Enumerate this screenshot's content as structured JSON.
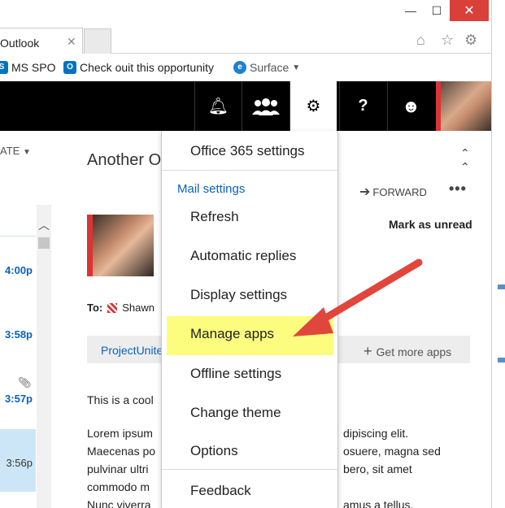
{
  "window": {
    "minimize_label": "—",
    "maximize_label": "☐",
    "close_label": "✕"
  },
  "tab": {
    "title": "Outlook",
    "close_label": "✕"
  },
  "favorites": [
    {
      "label": "MS SPO",
      "icon": "sharepoint-icon",
      "color": "#0072c6"
    },
    {
      "label": "Check ouit this opportunity",
      "icon": "outlook-icon",
      "color": "#0072c6"
    },
    {
      "label": "Surface",
      "icon": "ie-icon",
      "color": "#1e7fd2"
    }
  ],
  "header": {
    "icons": [
      "bell-icon",
      "people-icon",
      "gear-icon",
      "help-icon",
      "smiley-icon"
    ],
    "help_label": "?"
  },
  "message_list": {
    "sort_label": "ATE",
    "times": [
      "4:00p",
      "3:58p",
      "3:57p",
      "3:56p"
    ]
  },
  "reading_pane": {
    "subject": "Another O",
    "forward_label": "FORWARD",
    "mark_unread_label": "Mark as unread",
    "to_label": "To:",
    "to_name": "Shawn",
    "apps_link": "ProjectUnite",
    "get_more_apps": "Get more apps",
    "body_lines": [
      "This is a cool",
      "Lorem ipsum",
      "Maecenas po",
      "pulvinar ultri",
      "commodo m",
      "Nunc viverra"
    ],
    "body_right_lines": [
      "dipiscing elit.",
      "osuere, magna sed",
      "bero, sit amet",
      "",
      "amus a tellus."
    ]
  },
  "settings_menu": {
    "top_item": "Office 365 settings",
    "section_heading": "Mail settings",
    "items": [
      "Refresh",
      "Automatic replies",
      "Display settings",
      "Manage apps",
      "Offline settings",
      "Change theme",
      "Options"
    ],
    "bottom_item": "Feedback",
    "highlighted": "Manage apps",
    "highlight_color": "#fcfc7f",
    "arrow_color": "#e0463c"
  }
}
